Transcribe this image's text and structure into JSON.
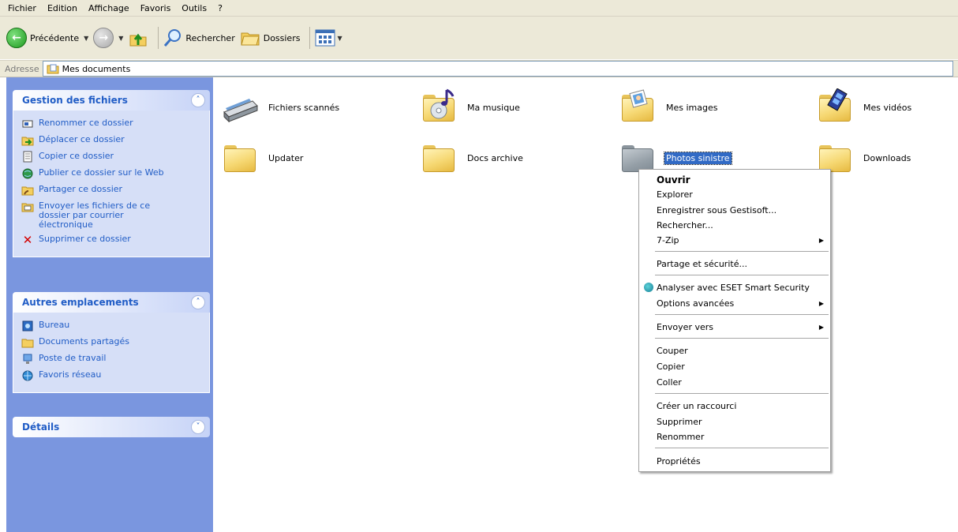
{
  "menubar": {
    "items": [
      "Fichier",
      "Edition",
      "Affichage",
      "Favoris",
      "Outils",
      "?"
    ]
  },
  "toolbar": {
    "back_label": "Précédente",
    "search_label": "Rechercher",
    "folders_label": "Dossiers"
  },
  "address": {
    "label": "Adresse",
    "value": "Mes documents"
  },
  "tasks_panel": {
    "title": "Gestion des fichiers",
    "items": [
      "Renommer ce dossier",
      "Déplacer ce dossier",
      "Copier ce dossier",
      "Publier ce dossier sur le Web",
      "Partager ce dossier",
      "Envoyer les fichiers de ce dossier par courrier électronique",
      "Supprimer ce dossier"
    ]
  },
  "places_panel": {
    "title": "Autres emplacements",
    "items": [
      "Bureau",
      "Documents partagés",
      "Poste de travail",
      "Favoris réseau"
    ]
  },
  "details_panel": {
    "title": "Détails"
  },
  "folders": [
    {
      "label": "Fichiers scannés",
      "icon": "scanner-icon"
    },
    {
      "label": "Ma musique",
      "icon": "music-folder-icon"
    },
    {
      "label": "Mes images",
      "icon": "pictures-folder-icon"
    },
    {
      "label": "Mes vidéos",
      "icon": "videos-folder-icon"
    },
    {
      "label": "Updater",
      "icon": "folder-icon"
    },
    {
      "label": "Docs archive",
      "icon": "folder-icon"
    },
    {
      "label": "Photos sinistre",
      "icon": "folder-icon",
      "selected": true
    },
    {
      "label": "Downloads",
      "icon": "folder-icon"
    }
  ],
  "context_menu": {
    "items": [
      "Ouvrir",
      "Explorer",
      "Enregistrer sous Gestisoft...",
      "Rechercher...",
      "7-Zip",
      "Partage et sécurité...",
      "Analyser avec ESET Smart Security",
      "Options avancées",
      "Envoyer vers",
      "Couper",
      "Copier",
      "Coller",
      "Créer un raccourci",
      "Supprimer",
      "Renommer",
      "Propriétés"
    ]
  },
  "colors": {
    "task_pane_bg": "#7a96df",
    "panel_title": "#215dc6",
    "selection": "#316ac5"
  }
}
